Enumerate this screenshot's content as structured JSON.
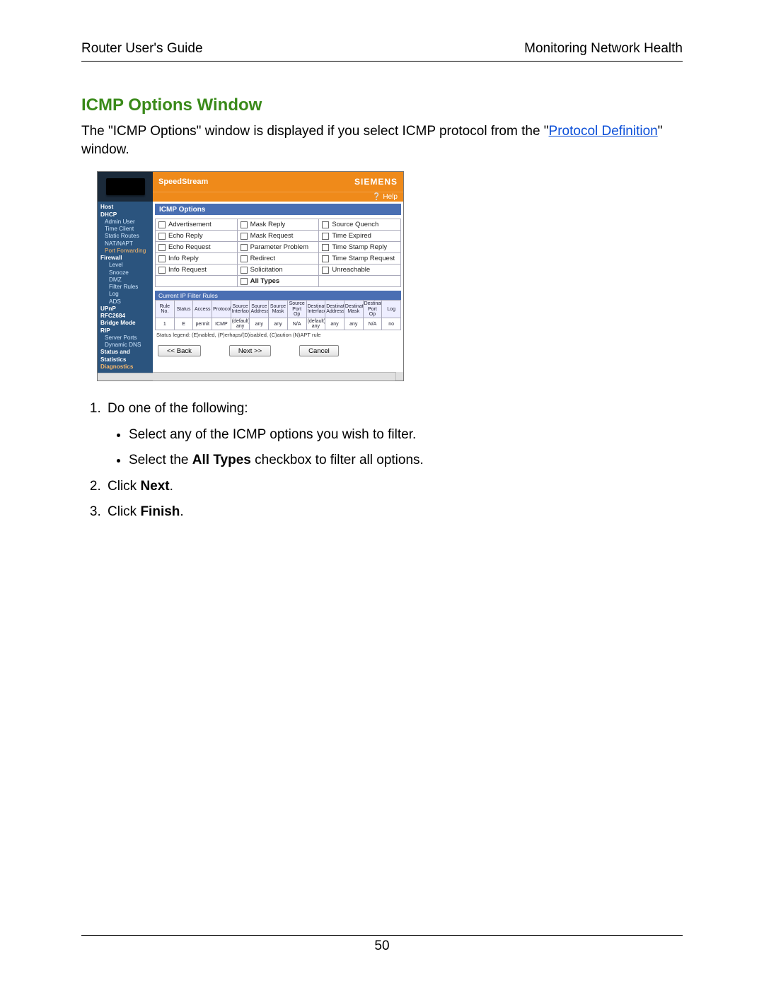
{
  "header": {
    "left": "Router User's Guide",
    "right": "Monitoring Network Health"
  },
  "title": "ICMP Options Window",
  "intro": {
    "p1a": "The \"ICMP Options\" window is displayed if you select ICMP protocol from the \"",
    "link": "Protocol Definition",
    "p1b": "\" window."
  },
  "shot": {
    "brand": "SpeedStream",
    "vendor": "SIEMENS",
    "help": "Help",
    "nav": [
      {
        "t": "Host",
        "c": "bold"
      },
      {
        "t": "DHCP",
        "c": "bold"
      },
      {
        "t": "Admin User",
        "c": "ind1"
      },
      {
        "t": "Time Client",
        "c": "ind1"
      },
      {
        "t": "Static Routes",
        "c": "ind1"
      },
      {
        "t": "NAT/NAPT",
        "c": "ind1"
      },
      {
        "t": "Port Forwarding",
        "c": "ind1 orange"
      },
      {
        "t": "Firewall",
        "c": "bold"
      },
      {
        "t": "Level",
        "c": "ind2"
      },
      {
        "t": "Snooze",
        "c": "ind2"
      },
      {
        "t": "DMZ",
        "c": "ind2"
      },
      {
        "t": "Filter Rules",
        "c": "ind2"
      },
      {
        "t": "Log",
        "c": "ind2"
      },
      {
        "t": "ADS",
        "c": "ind2"
      },
      {
        "t": "UPnP",
        "c": "bold"
      },
      {
        "t": "RFC2684",
        "c": "bold"
      },
      {
        "t": "Bridge Mode",
        "c": "bold"
      },
      {
        "t": "RIP",
        "c": "bold"
      },
      {
        "t": "Server Ports",
        "c": "ind1"
      },
      {
        "t": "Dynamic DNS",
        "c": "ind1"
      },
      {
        "t": "Status and",
        "c": "bold"
      },
      {
        "t": "Statistics",
        "c": "bold"
      },
      {
        "t": "Diagnostics",
        "c": "bold orange"
      }
    ],
    "pane_title": "ICMP Options",
    "options": [
      [
        "Advertisement",
        "Mask Reply",
        "Source Quench"
      ],
      [
        "Echo Reply",
        "Mask Request",
        "Time Expired"
      ],
      [
        "Echo Request",
        "Parameter Problem",
        "Time Stamp Reply"
      ],
      [
        "Info Reply",
        "Redirect",
        "Time Stamp Request"
      ],
      [
        "Info Request",
        "Solicitation",
        "Unreachable"
      ],
      [
        "",
        "All Types",
        ""
      ]
    ],
    "rules_title": "Current IP Filter Rules",
    "rules_headers": [
      "Rule No.",
      "Status",
      "Access",
      "Protocol",
      "Source Interface",
      "Source Address",
      "Source Mask",
      "Source Port Op",
      "Destination Interface",
      "Destination Address",
      "Destination Mask",
      "Destination Port Op",
      "Log"
    ],
    "rules_row": [
      "1",
      "E",
      "permit",
      "ICMP",
      "(default) any",
      "any",
      "any",
      "N/A",
      "(default) any",
      "any",
      "any",
      "N/A",
      "no"
    ],
    "legend": "Status legend: (E)nabled, (P)erhaps/(D)isabled, (C)aution (N)APT rule",
    "btn_back": "<< Back",
    "btn_next": "Next >>",
    "btn_cancel": "Cancel"
  },
  "steps": {
    "s1": "Do one of the following:",
    "s1a": "Select any of the ICMP options you wish to filter.",
    "s1b_pre": "Select the ",
    "s1b_bold": "All Types",
    "s1b_post": " checkbox to filter all options.",
    "s2_pre": "Click ",
    "s2_bold": "Next",
    "s2_post": ".",
    "s3_pre": "Click ",
    "s3_bold": "Finish",
    "s3_post": "."
  },
  "page_number": "50"
}
